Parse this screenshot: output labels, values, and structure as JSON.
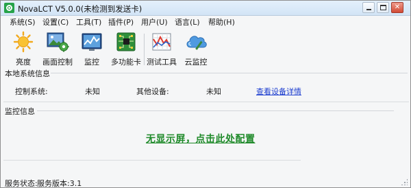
{
  "window": {
    "title": "NovaLCT V5.0.0(未检测到发送卡)",
    "controls": {
      "close": "✕"
    }
  },
  "menu": [
    {
      "label": "系统(S)"
    },
    {
      "label": "设置(C)"
    },
    {
      "label": "工具(T)"
    },
    {
      "label": "插件(P)"
    },
    {
      "label": "用户(U)"
    },
    {
      "label": "语言(L)"
    },
    {
      "label": "帮助(H)"
    }
  ],
  "toolbar": [
    {
      "label": "亮度",
      "icon": "sun-icon"
    },
    {
      "label": "画面控制",
      "icon": "screen-control-icon"
    },
    {
      "label": "监控",
      "icon": "monitor-chart-icon"
    },
    {
      "label": "多功能卡",
      "icon": "circuit-board-icon"
    },
    {
      "label": "测试工具",
      "icon": "test-chart-icon"
    },
    {
      "label": "云监控",
      "icon": "cloud-icon"
    }
  ],
  "system_info": {
    "group_title": "本地系统信息",
    "control_system_label": "控制系统:",
    "control_system_value": "未知",
    "other_devices_label": "其他设备:",
    "other_devices_value": "未知",
    "details_link": "查看设备详情"
  },
  "monitor": {
    "group_title": "监控信息",
    "no_screen_link": "无显示屏，点击此处配置"
  },
  "status": {
    "service_status_label": "服务状态:",
    "service_version_label": "服务版本:3.1"
  },
  "colors": {
    "link_blue": "#1b3ccf",
    "config_green": "#1f8a2a",
    "close_red": "#d24a35"
  }
}
